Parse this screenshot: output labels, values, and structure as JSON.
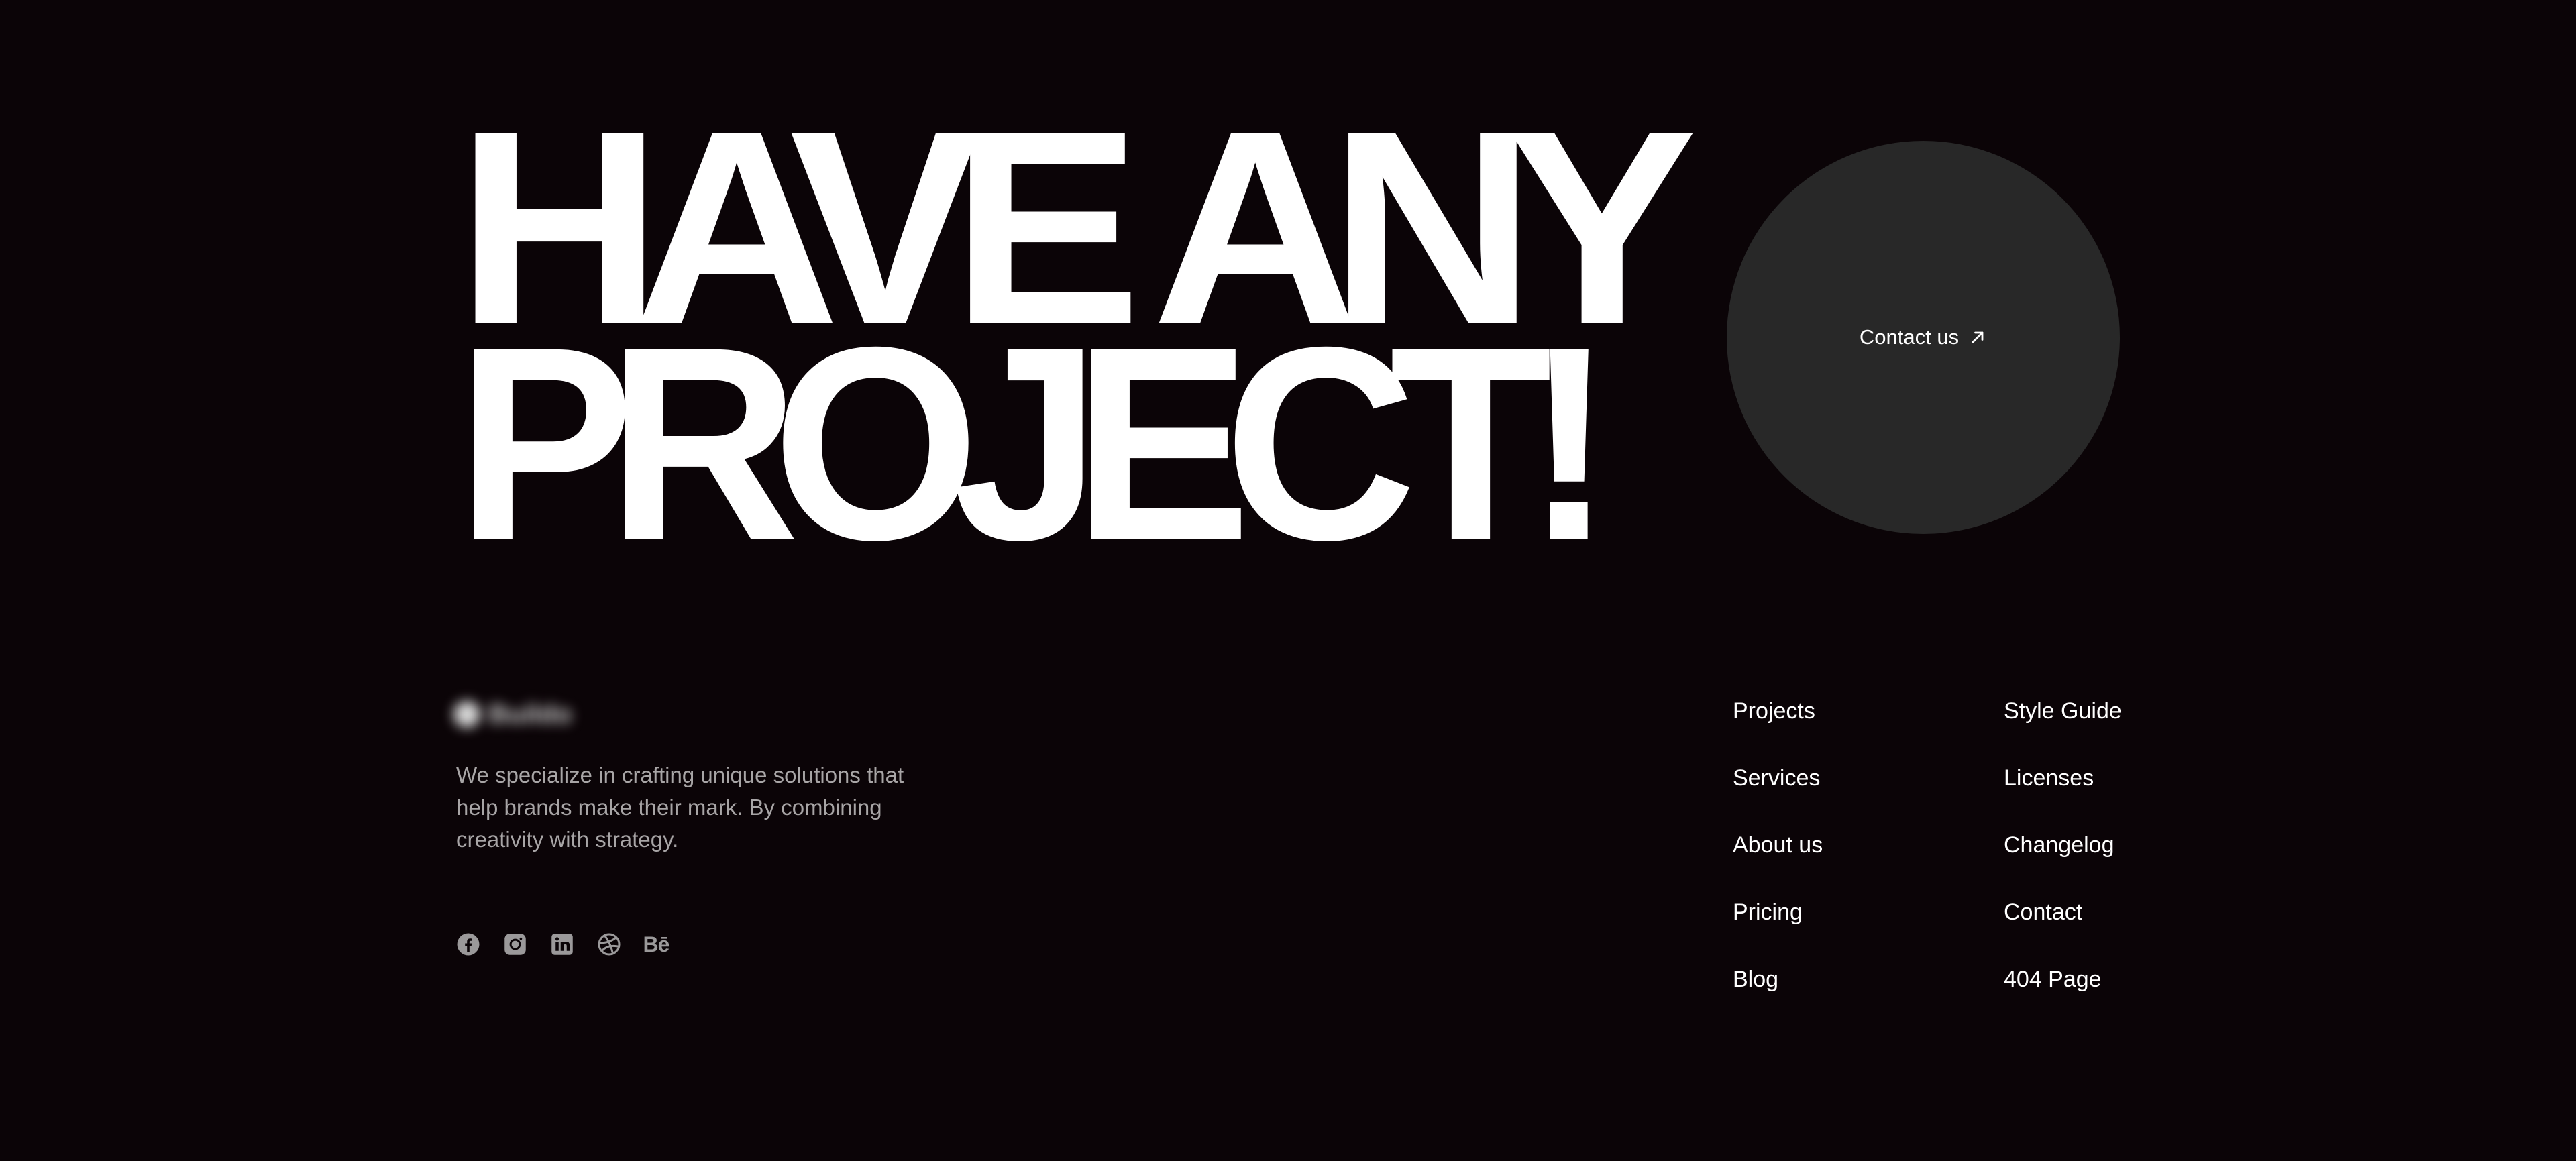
{
  "hero": {
    "headline_line1": "HAVE ANY",
    "headline_line2": "PROJECT!",
    "contact_label": "Contact us",
    "contact_icon": "arrow-up-right-icon",
    "circle_color": "#282828"
  },
  "brand": {
    "logo_text": "Buildo",
    "description": "We specialize in crafting unique solutions that help brands make their mark. By combining creativity with strategy."
  },
  "socials": [
    {
      "icon": "facebook-icon"
    },
    {
      "icon": "instagram-icon"
    },
    {
      "icon": "linkedin-icon"
    },
    {
      "icon": "dribbble-icon"
    },
    {
      "icon": "behance-icon",
      "text": "Bē"
    }
  ],
  "nav": {
    "col1": [
      "Projects",
      "Services",
      "About us",
      "Pricing",
      "Blog"
    ],
    "col2": [
      "Style Guide",
      "Licenses",
      "Changelog",
      "Contact",
      "404 Page"
    ]
  },
  "colors": {
    "background": "#0b0407",
    "text": "#ffffff",
    "muted_text": "#a8a5a6"
  }
}
